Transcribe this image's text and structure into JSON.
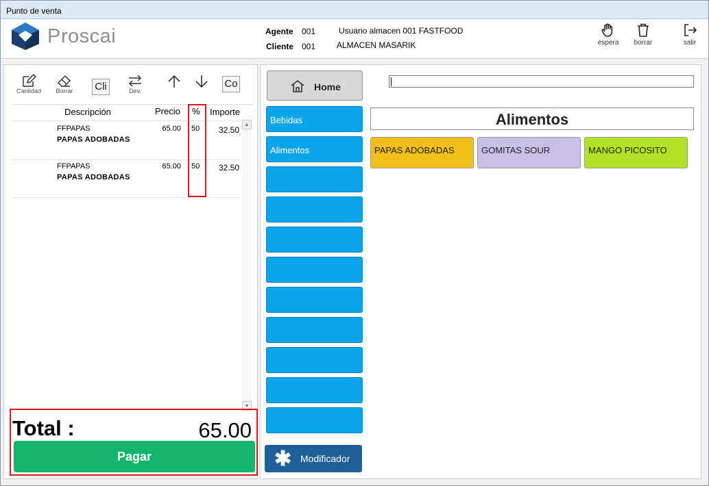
{
  "window": {
    "title": "Punto de venta"
  },
  "header": {
    "logo_text": "Proscai",
    "agente_label": "Agente",
    "agente_code": "001",
    "agente_name": "Usuario almacen 001 FASTFOOD",
    "cliente_label": "Cliente",
    "cliente_code": "001",
    "cliente_name": "ALMACEN MASARIK",
    "buttons": {
      "espera": "espera",
      "borrar": "borrar",
      "salir": "salir"
    }
  },
  "toolbar": {
    "cantidad": "Cantidad",
    "borrar": "Borrar",
    "cli": "Cli",
    "dev": "Dev.",
    "co": "Co"
  },
  "ticket": {
    "columns": {
      "descripcion": "Descripción",
      "precio": "Precio",
      "pct": "%",
      "importe": "Importe"
    },
    "rows": [
      {
        "code": "FFPAPAS",
        "desc": "PAPAS ADOBADAS",
        "precio": "65.00",
        "pct": "50",
        "importe": "32.50"
      },
      {
        "code": "FFPAPAS",
        "desc": "PAPAS ADOBADAS",
        "precio": "65.00",
        "pct": "50",
        "importe": "32.50"
      }
    ],
    "total_label": "Total :",
    "total_value": "65.00",
    "pay_label": "Pagar"
  },
  "categories": {
    "home_label": "Home",
    "items": [
      "Bebidas",
      "Alimentos",
      "",
      "",
      "",
      "",
      "",
      "",
      "",
      "",
      ""
    ],
    "modifier_label": "Modificador"
  },
  "products": {
    "search_value": "",
    "section_title": "Alimentos",
    "items": [
      {
        "label": "PAPAS ADOBADAS",
        "color": "#f0bf1a"
      },
      {
        "label": "GOMITAS SOUR",
        "color": "#c8c0e6"
      },
      {
        "label": "MANGO PICOSITO",
        "color": "#b2e126"
      }
    ]
  },
  "colors": {
    "accent_blue": "#0da5ea",
    "pay_green": "#12b56a",
    "highlight_red": "#e0141e",
    "modifier_blue": "#1f5f97"
  }
}
